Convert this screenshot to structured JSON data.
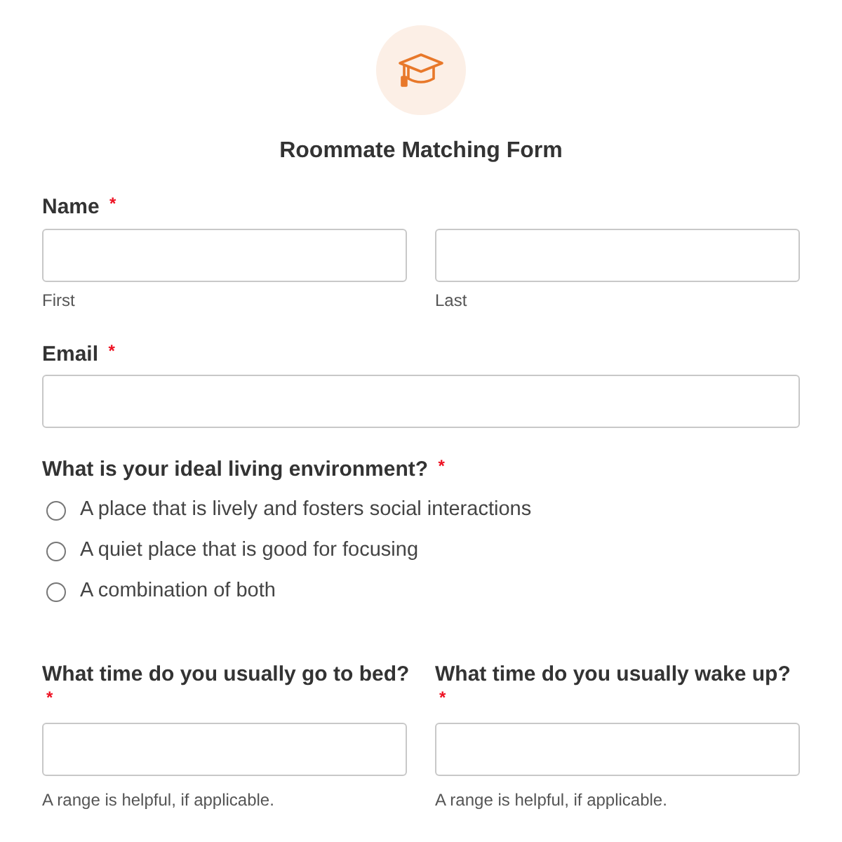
{
  "form": {
    "title": "Roommate Matching Form"
  },
  "name_field": {
    "label": "Name",
    "required": "*",
    "sublabels": [
      "First",
      "Last"
    ]
  },
  "email_field": {
    "label": "Email",
    "required": "*"
  },
  "environment": {
    "label": "What is your ideal living environment?",
    "required": "*",
    "options": [
      {
        "label": "A place that is lively and fosters social interactions",
        "selected": false
      },
      {
        "label": "A quiet place that is good for focusing",
        "selected": false
      },
      {
        "label": "A combination of both",
        "selected": false
      }
    ]
  },
  "time_fields": [
    {
      "label": "What time do you usually go to bed?",
      "required": "*",
      "help": "A range is helpful, if applicable."
    },
    {
      "label": "What time do you usually wake up?",
      "required": "*",
      "help": "A range is helpful, if applicable."
    }
  ]
}
